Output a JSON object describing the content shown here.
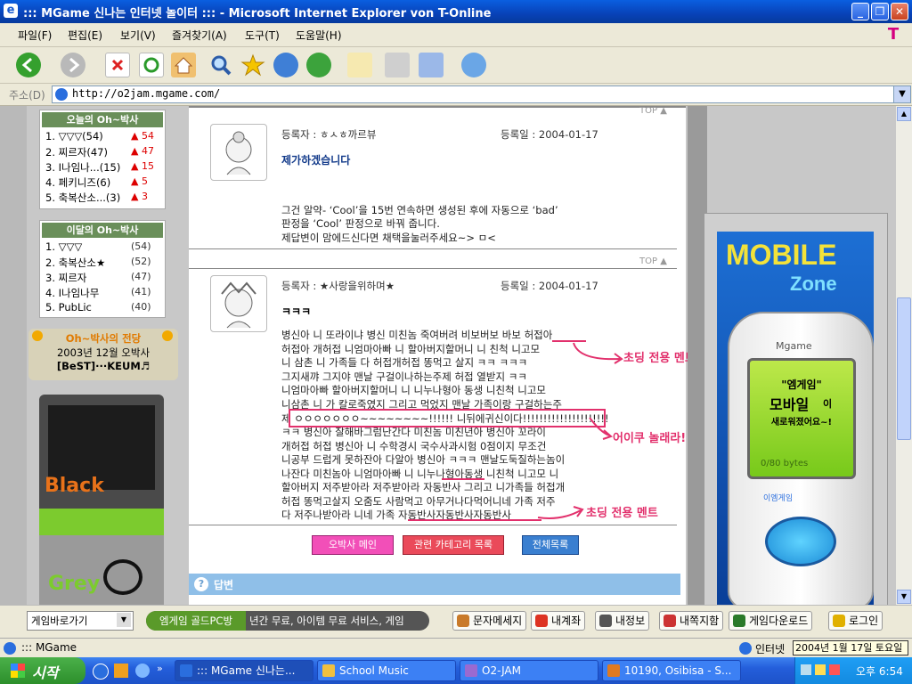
{
  "window": {
    "title": "::: MGame 신나는 인터넷 놀이터 ::: - Microsoft Internet Explorer von T-Online",
    "icon": "ie-icon"
  },
  "menu": [
    "파일(F)",
    "편집(E)",
    "보기(V)",
    "즐겨찾기(A)",
    "도구(T)",
    "도움말(H)"
  ],
  "address": {
    "label": "주소(D)",
    "url": "http://o2jam.mgame.com/"
  },
  "sidebar": {
    "today": {
      "title": "오늘의 Oh~박사",
      "items": [
        {
          "rank": "1. ▽▽▽(54)",
          "delta": "▲ 54"
        },
        {
          "rank": "2. 찌르자(47)",
          "delta": "▲ 47"
        },
        {
          "rank": "3. I나임나...(15)",
          "delta": "▲ 15"
        },
        {
          "rank": "4. 페키니즈(6)",
          "delta": "▲ 5"
        },
        {
          "rank": "5. 축복산소...(3)",
          "delta": "▲ 3"
        }
      ]
    },
    "month": {
      "title": "이달의 Oh~박사",
      "items": [
        {
          "rank": "1. ▽▽▽",
          "count": "(54)"
        },
        {
          "rank": "2. 축복산소★",
          "count": "(52)"
        },
        {
          "rank": "3. 찌르자",
          "count": "(47)"
        },
        {
          "rank": "4. I나임나무",
          "count": "(41)"
        },
        {
          "rank": "5. PubLic",
          "count": "(40)"
        }
      ]
    },
    "hall": {
      "title": "Oh~박사의 전당",
      "line1": "2003년 12월 오박사",
      "line2": "[BeST]···KEUM♬"
    },
    "shirt_text1": "Black",
    "shirt_text2": "Grey"
  },
  "posts": [
    {
      "top_label": "TOP ▲",
      "author_label": "등록자 : ㅎㅅㅎ까르뷰",
      "date_label": "등록일 : 2004-01-17",
      "title": "제가하겠습니다",
      "body": [
        "그건 알약- ‘Cool’을 15번 연속하면 생성된 후에 자동으로 ‘bad’",
        "판정을 ‘Cool’ 판정으로 바꿔 줍니다.",
        "제답변이 맘에드신다면 채택을눌러주세요~> ㅁ<"
      ]
    },
    {
      "top_label": "TOP ▲",
      "author_label": "등록자 : ★사랑을위하며★",
      "date_label": "등록일 : 2004-01-17",
      "title": "ㅋㅋㅋ",
      "body": [
        "병신아 니 또라이냐 병신 미친놈 죽여버려 비보버보 바보 허접아",
        "허접아 개허접 니엄마아빠 니 할아버지할머니 니 친척 니고모",
        "니 삼촌 니 가족들 다 허접개허접 똥먹고 살지 ㅋㅋ ㅋㅋㅋ",
        "그지새꺄 그지야 맨날 구걸이나하는주제 허접 열받지 ㅋㅋ",
        "니엄마아빠 할아버지할머니 니 니누나형아 동생 니친척 니고모",
        "니삼촌 니 가 칼로죽였지 그리고 먹었지 맨날 가족이랑 구걸하는주",
        "제 ㅇㅇㅇㅇㅇㅇㅇ~~~~~~~~!!!!!! 니뒤에귀신이다!!!!!!!!!!!!!!!!!!!!!",
        "ㅋㅋ 병신아 잘해바그럼난간다 미친놈 미친년아 병신아 꼬라이",
        "개허접 허접 병신아 니 수학경시 국수사과시험 0점이지 무조건",
        "니공부 드럽게 못하잔아 다알아 병신아 ㅋㅋㅋ 맨날도둑질하는놈이",
        "나잔다 미친놈아 니엄마아빠 니 니누나형아동생 니친척 니고모 니",
        "할아버지 저주받아라 저주받아라 자동반사 그리고 니가족들 허접개",
        "허접 똥먹고살지 오줌도 사람먹고 아무거나다먹어니네 가족 저주",
        "다 저주나받아라 니네 가족 자동반사자동반사자동반사"
      ]
    }
  ],
  "annotations": {
    "note1": "초딩 전용 멘트",
    "note2": "어이쿠 놀래라!!!",
    "note3": "초딩 전용 멘트"
  },
  "action_buttons": [
    "오박사 메인",
    "관련 카테고리 목록",
    "전체목록"
  ],
  "answer_header": "답변",
  "ad": {
    "title1": "MOBILE",
    "title2": "Zone",
    "brand": "Mgame",
    "screen_line1": "\"엠게임\"",
    "screen_line2": "모바일",
    "screen_line2b": "이",
    "screen_line3": "새로워졌어요~!",
    "bytes": "0/80 bytes",
    "keypad": "이엠게임"
  },
  "pagebar": {
    "select_label": "게임바로가기",
    "gold_pc": "엠게임 골드PC방",
    "promo": "년간 무료, 아이템 무료 서비스, 게임",
    "buttons": [
      "문자메세지",
      "내계좌",
      "내정보",
      "내쪽지함",
      "게임다운로드",
      "로그인"
    ]
  },
  "status": {
    "left": "::: MGame",
    "zone": "인터넷",
    "date": "2004년 1월 17일 토요일"
  },
  "taskbar": {
    "start": "시작",
    "tasks": [
      {
        "label": "::: MGame 신나는...",
        "active": true
      },
      {
        "label": "School Music",
        "active": false
      },
      {
        "label": "O2-JAM",
        "active": false
      },
      {
        "label": "10190, Osibisa - S...",
        "active": false
      }
    ],
    "clock": "오후 6:54"
  },
  "colors": {
    "pink_note": "#e2306c",
    "sidebar_head": "#6a8f5a",
    "answer_bar": "#8fbfe8"
  }
}
